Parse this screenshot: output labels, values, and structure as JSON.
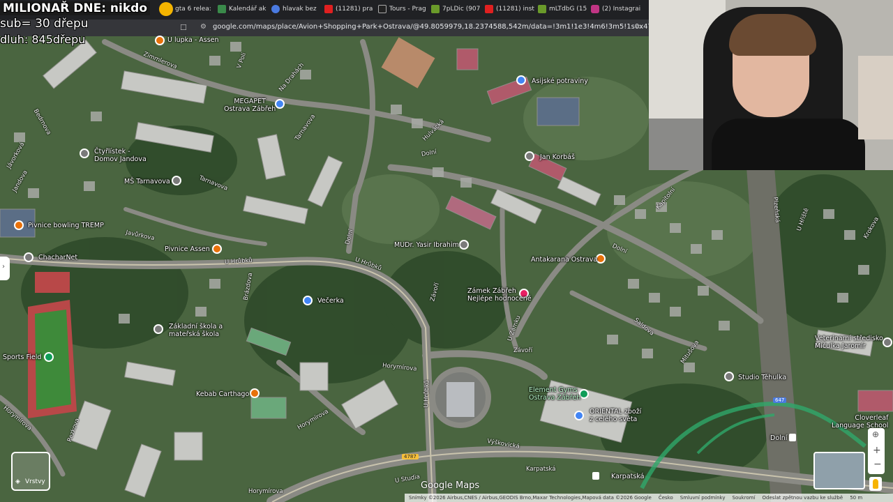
{
  "overlay": {
    "title": "MILIONAŘ DNE: nikdo",
    "sub": "sub= 30 dřepu",
    "dluh": "dluh: 845dřepu"
  },
  "browser": {
    "tabs": [
      {
        "label": "gta 6 relea:",
        "color": "#7b7b7b"
      },
      {
        "label": "Kalendář ak",
        "color": "#3a8a4a"
      },
      {
        "label": "hlavak bez",
        "color": "#4a7ae0"
      },
      {
        "label": "(11281) pra",
        "color": "#e02020"
      },
      {
        "label": "Tours - Prag",
        "color": "#222222"
      },
      {
        "label": "7pLDic (907",
        "color": "#6a9a2a"
      },
      {
        "label": "(11281) inst",
        "color": "#e02020"
      },
      {
        "label": "mLTdbG (15",
        "color": "#6a9a2a"
      },
      {
        "label": "(2) Instagrai",
        "color": "#c13584"
      }
    ],
    "url": "google.com/maps/place/Avion+Shopping+Park+Ostrava/@49.8059979,18.2374588,542m/data=!3m1!1e3!4m6!3m5!1s0x4713e48e97678bd1:0..."
  },
  "map": {
    "places": [
      {
        "name": "U lupka - Assen",
        "icon": "food-pin",
        "color": "#e8710a"
      },
      {
        "name": "MEGAPET\nOstrava Zábřeh",
        "icon": "shop-pin",
        "color": "#4285f4"
      },
      {
        "name": "Asijské potraviny",
        "icon": "shop-pin",
        "color": "#4285f4"
      },
      {
        "name": "Čtyřlístek -\nDomov Jandova",
        "icon": "place-pin",
        "color": "#7a7a7a"
      },
      {
        "name": "Jan Korbáš",
        "icon": "place-pin",
        "color": "#7a7a7a"
      },
      {
        "name": "MŠ Tarnavova",
        "icon": "school-pin",
        "color": "#7a7a7a"
      },
      {
        "name": "Pivnice bowling TREMP",
        "icon": "food-pin",
        "color": "#e8710a"
      },
      {
        "name": "Pivnice Assen",
        "icon": "food-pin",
        "color": "#e8710a"
      },
      {
        "name": "MUDr. Yasir Ibrahim",
        "icon": "place-pin",
        "color": "#7a7a7a"
      },
      {
        "name": "ChacharNet",
        "icon": "place-pin",
        "color": "#7a7a7a"
      },
      {
        "name": "Antakarana Ostrava",
        "icon": "place-pin",
        "color": "#e8710a"
      },
      {
        "name": "Zámek Zábřeh\nNejlépe hodnocené",
        "icon": "hotel-pin",
        "color": "#e91e63"
      },
      {
        "name": "Večerka",
        "icon": "shop-pin",
        "color": "#4285f4"
      },
      {
        "name": "Základní škola a\nmateřská škola",
        "icon": "school-pin",
        "color": "#7a7a7a"
      },
      {
        "name": "Sports Field",
        "icon": "sport-pin",
        "color": "#0f9d58"
      },
      {
        "name": "Veterinarní středisko\nMičulka Jaromír",
        "icon": "place-pin",
        "color": "#7a7a7a"
      },
      {
        "name": "Studio Těhulka",
        "icon": "place-pin",
        "color": "#7a7a7a"
      },
      {
        "name": "Element Gyms\nOstrava Zábřeh",
        "icon": "sport-pin",
        "color": "#0f9d58"
      },
      {
        "name": "ORIENTAL zboží\nz celého světa",
        "icon": "shop-pin",
        "color": "#4285f4"
      },
      {
        "name": "Kebab Carthago",
        "icon": "food-pin",
        "color": "#e8710a"
      },
      {
        "name": "Cloverleaf\nLanguage School",
        "icon": "place-pin",
        "color": "#7a7a7a"
      },
      {
        "name": "Dolní",
        "icon": "bus-stop",
        "color": "#555555"
      },
      {
        "name": "Karpatská",
        "icon": "bus-stop",
        "color": "#555555"
      }
    ],
    "streets": [
      "Zimmlerova",
      "V Poli",
      "Na Drahách",
      "Bedrnova",
      "Jandova",
      "Jávorková",
      "Tarnavova",
      "Tarnavova",
      "Javůrkova",
      "U Hrůbků",
      "U Hrůbků",
      "Brázdova",
      "Hulvácká",
      "Dolní",
      "Dolní",
      "Dolní",
      "Závoří",
      "Závoří",
      "U Zámku",
      "Horymírova",
      "Horymírova",
      "Horymírova",
      "U Hrůbků",
      "Výškovická",
      "Karpatská",
      "U Studia",
      "Saldova",
      "Mitušova",
      "Kapitolní",
      "Plzeňská",
      "U Hřiště",
      "Krokova",
      "Rezkova",
      "Horymírova"
    ],
    "road_shields": [
      "4787",
      "647"
    ],
    "layers_label": "Vrstvy",
    "brand": "Google Maps",
    "scale": "50 m"
  },
  "footer": {
    "items": [
      "Snímky ©2026 Airbus,CNES / Airbus,GEODIS Brno,Maxar Technologies,Mapová data ©2026 Google",
      "Česko",
      "Smluvní podmínky",
      "Soukromí",
      "Odeslat zpětnou vazbu ke službě",
      "50 m"
    ]
  }
}
